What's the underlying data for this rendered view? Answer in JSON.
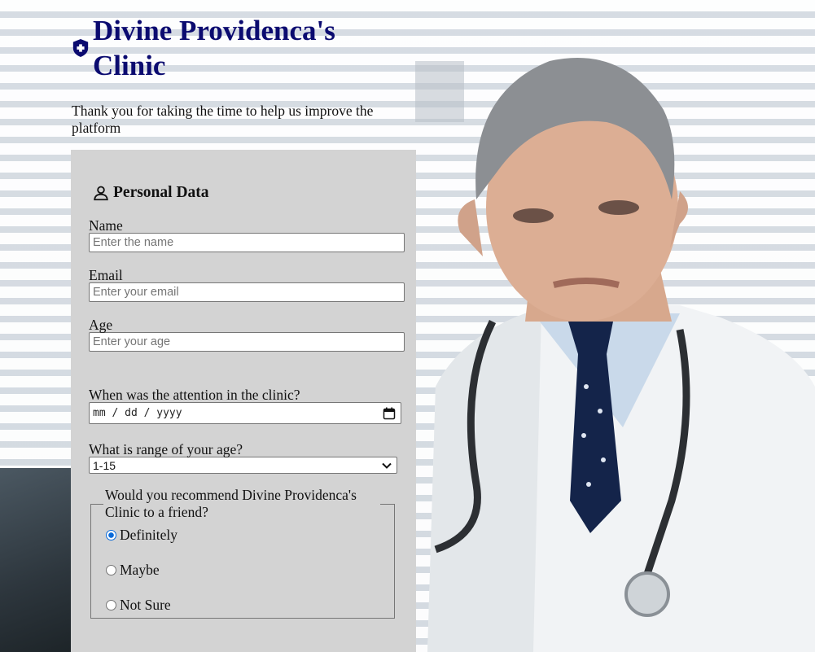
{
  "header": {
    "title": "Divine Providenca's Clinic",
    "intro": "Thank you for taking the time to help us improve the platform"
  },
  "personal_data": {
    "heading": "Personal Data",
    "name": {
      "label": "Name",
      "placeholder": "Enter the name"
    },
    "email": {
      "label": "Email",
      "placeholder": "Enter your email"
    },
    "age": {
      "label": "Age",
      "placeholder": "Enter your age"
    }
  },
  "attention_date": {
    "label": "When was the attention in the clinic?",
    "value": "mm / dd / yyyy"
  },
  "age_range": {
    "label": "What is range of your age?",
    "selected": "1-15"
  },
  "recommend": {
    "legend": "Would you recommend Divine Providenca's Clinic to a friend?",
    "options": [
      "Definitely",
      "Maybe",
      "Not Sure"
    ],
    "selected": "Definitely"
  },
  "colors": {
    "title": "#0b0b70",
    "card": "#d3d3d3",
    "radio_checked": "#0a6ad9"
  },
  "icons": {
    "logo": "shield-plus-icon",
    "personal": "user-outline-icon",
    "calendar": "calendar-icon",
    "dropdown": "chevron-down-icon"
  }
}
